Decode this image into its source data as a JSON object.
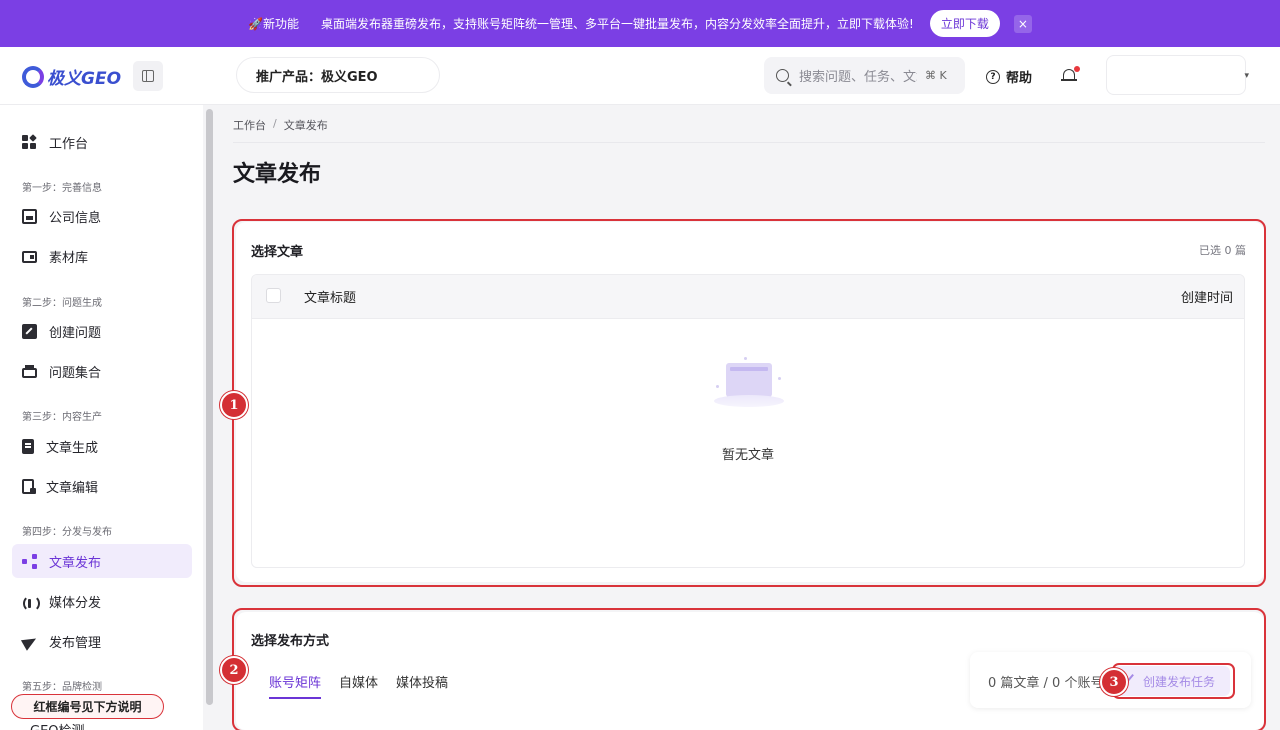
{
  "announcement": {
    "tag": "🚀新功能",
    "message": "桌面端发布器重磅发布，支持账号矩阵统一管理、多平台一键批量发布，内容分发效率全面提升，立即下载体验!",
    "button": "立即下载",
    "close": "×"
  },
  "header": {
    "logo_text": "极义GEO",
    "product_label": "推广产品：极义GEO",
    "search_placeholder": "搜索问题、任务、文章",
    "search_shortcut": "⌘ K",
    "help_label": "帮助",
    "help_icon_glyph": "?",
    "caret": "▾"
  },
  "sidebar": {
    "top_item": "工作台",
    "sections": [
      {
        "label": "第一步：完善信息",
        "items": [
          "公司信息",
          "素材库"
        ]
      },
      {
        "label": "第二步：问题生成",
        "items": [
          "创建问题",
          "问题集合"
        ]
      },
      {
        "label": "第三步：内容生产",
        "items": [
          "文章生成",
          "文章编辑"
        ]
      },
      {
        "label": "第四步：分发与发布",
        "items": [
          "文章发布",
          "媒体分发",
          "发布管理"
        ]
      },
      {
        "label": "第五步：品牌检测",
        "items": [
          "GEO检测"
        ]
      }
    ],
    "active_item": "文章发布",
    "note": "红框编号见下方说明"
  },
  "breadcrumb": [
    "工作台",
    "文章发布"
  ],
  "breadcrumb_separator": "/",
  "page_title": "文章发布",
  "select_article": {
    "title": "选择文章",
    "selected_count": "已选 0 篇",
    "columns": [
      "文章标题",
      "创建时间"
    ],
    "empty_text": "暂无文章"
  },
  "publish_method": {
    "title": "选择发布方式",
    "tabs": [
      "账号矩阵",
      "自媒体",
      "媒体投稿"
    ],
    "active_tab": "账号矩阵",
    "summary": "0 篇文章 / 0 个账号",
    "create_button": "创建发布任务"
  },
  "annotations": [
    "1",
    "2",
    "3"
  ],
  "colors": {
    "brand": "#7b3fe4",
    "annotation_red": "#d9333a"
  }
}
